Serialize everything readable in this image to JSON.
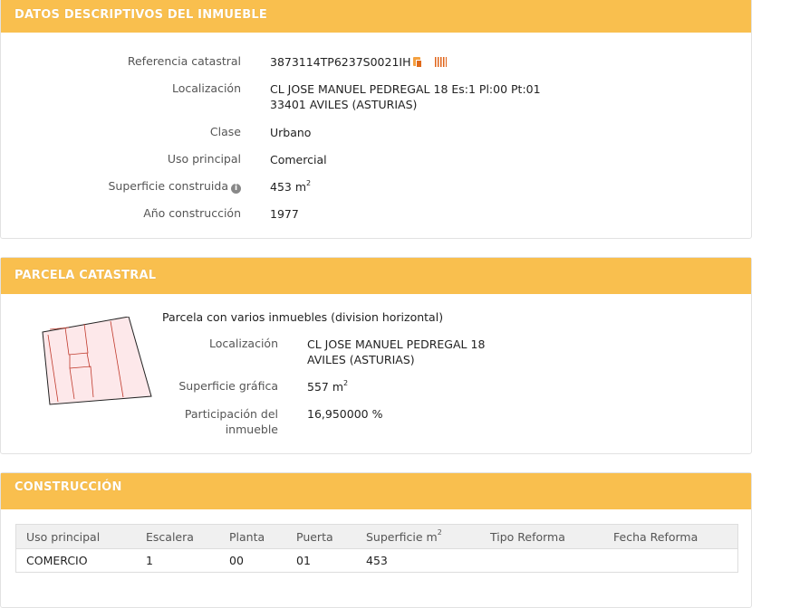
{
  "datos": {
    "title": "DATOS DESCRIPTIVOS DEL INMUEBLE",
    "ref_label": "Referencia catastral",
    "ref_value": "3873114TP6237S0021IH",
    "loc_label": "Localización",
    "loc_line1": "CL JOSE MANUEL PEDREGAL 18 Es:1 Pl:00 Pt:01",
    "loc_line2": "33401 AVILES (ASTURIAS)",
    "clase_label": "Clase",
    "clase_value": "Urbano",
    "uso_label": "Uso principal",
    "uso_value": "Comercial",
    "sup_label": "Superficie construida",
    "sup_value": "453 m",
    "sup_unit_exp": "2",
    "anio_label": "Año construcción",
    "anio_value": "1977"
  },
  "parcela": {
    "title": "PARCELA CATASTRAL",
    "description": "Parcela con varios inmuebles (division horizontal)",
    "loc_label": "Localización",
    "loc_line1": "CL JOSE MANUEL PEDREGAL 18",
    "loc_line2": "AVILES (ASTURIAS)",
    "sup_label": "Superficie gráfica",
    "sup_value": "557 m",
    "sup_unit_exp": "2",
    "part_label_1": "Participación del",
    "part_label_2": "inmueble",
    "part_value": "16,950000 %"
  },
  "construccion": {
    "title": "CONSTRUCCIÓN",
    "headers": [
      "Uso principal",
      "Escalera",
      "Planta",
      "Puerta",
      "Superficie m",
      "Tipo Reforma",
      "Fecha Reforma"
    ],
    "sup_header_exp": "2",
    "rows": [
      [
        "COMERCIO",
        "1",
        "00",
        "01",
        "453",
        "",
        ""
      ]
    ]
  },
  "colors": {
    "header": "#f9bf4e",
    "parcel_fill": "#fde8ea",
    "parcel_line": "#c0392b",
    "icon": "#e0641a"
  },
  "icons": [
    "copy-icon",
    "barcode-icon",
    "info-icon"
  ]
}
